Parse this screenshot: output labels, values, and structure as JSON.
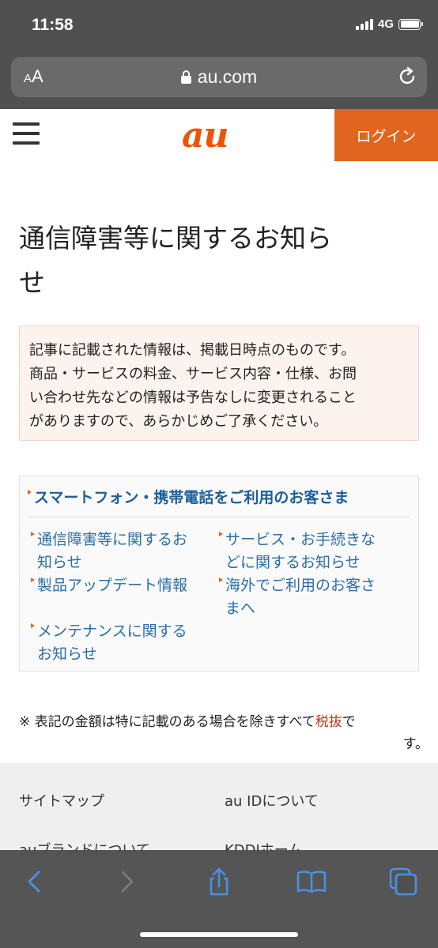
{
  "status": {
    "time": "11:58",
    "network": "4G"
  },
  "browser": {
    "text_size_small": "A",
    "text_size_big": "A",
    "url": "au.com"
  },
  "header": {
    "logo": "au",
    "login_label": "ログイン"
  },
  "page": {
    "title_line1": "通信障害等に関するお知ら",
    "title_line2": "せ",
    "notice_lines": [
      "記事に記載された情報は、掲載日時点のものです。",
      "商品・サービスの料金、サービス内容・仕様、お問",
      "い合わせ先などの情報は予告なしに変更されること",
      "がありますので、あらかじめご了承ください。"
    ]
  },
  "nav": {
    "heading": "スマートフォン・携帯電話をご利用のお客さま",
    "items": [
      {
        "line1": "通信障害等に関するお",
        "line2": "知らせ"
      },
      {
        "line1": "サービス・お手続きな",
        "line2": "どに関するお知らせ"
      },
      {
        "line1": "製品アップデート情報",
        "line2": ""
      },
      {
        "line1": "海外でご利用のお客さ",
        "line2": "まへ"
      },
      {
        "line1": "メンテナンスに関する",
        "line2": "お知らせ"
      }
    ]
  },
  "tax_note": {
    "prefix": "※ 表記の金額は特に記載のある場合を除きすべて",
    "link": "税抜",
    "suffix_line1": "で",
    "suffix_line2": "す。"
  },
  "footer": {
    "links": [
      "サイトマップ",
      "au IDについて",
      "auブランドについて",
      "KDDIホーム"
    ]
  },
  "toolbar": {
    "back": "chevron-left-icon",
    "forward": "chevron-right-icon",
    "share": "share-icon",
    "bookmarks": "book-icon",
    "tabs": "tabs-icon"
  },
  "colors": {
    "brand": "#eb5505",
    "login_bg": "#e1641f",
    "link": "#2a6ea8",
    "nav_heading": "#1c5e9b",
    "tax_link": "#d4321d"
  }
}
